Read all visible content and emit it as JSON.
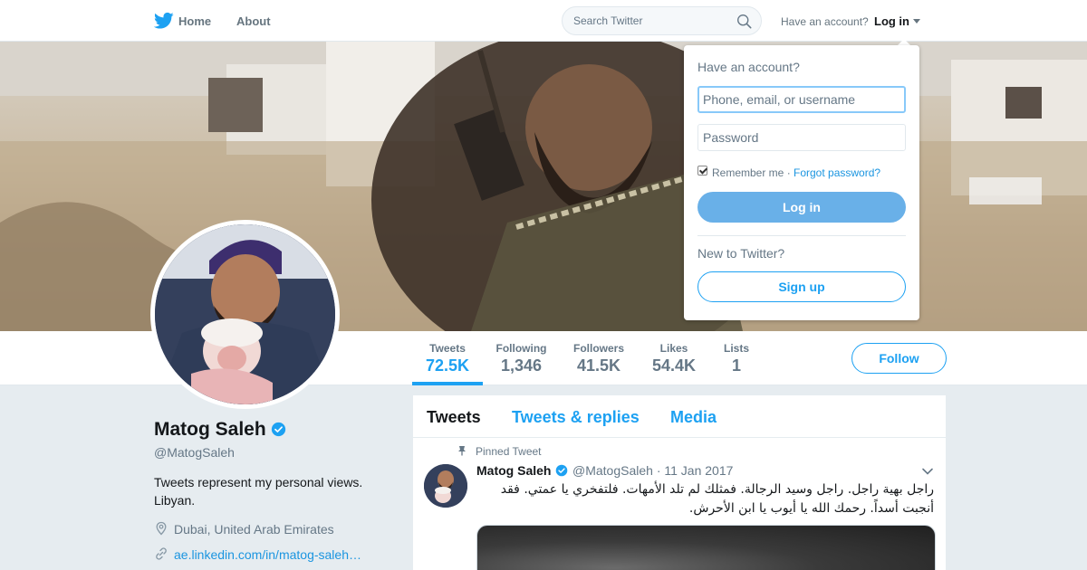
{
  "nav": {
    "home_label": "Home",
    "about_label": "About",
    "search_placeholder": "Search Twitter",
    "have_account": "Have an account?",
    "login_label": "Log in"
  },
  "profile": {
    "name": "Matog Saleh",
    "handle": "@MatogSaleh",
    "bio": "Tweets represent my personal views. Libyan.",
    "location": "Dubai, United Arab Emirates",
    "link": "ae.linkedin.com/in/matog-saleh…",
    "follow_label": "Follow"
  },
  "stats": [
    {
      "label": "Tweets",
      "value": "72.5K"
    },
    {
      "label": "Following",
      "value": "1,346"
    },
    {
      "label": "Followers",
      "value": "41.5K"
    },
    {
      "label": "Likes",
      "value": "54.4K"
    },
    {
      "label": "Lists",
      "value": "1"
    }
  ],
  "timeline": {
    "tabs": [
      "Tweets",
      "Tweets & replies",
      "Media"
    ],
    "pinned_label": "Pinned Tweet",
    "tweet": {
      "author": "Matog Saleh",
      "meta": "@MatogSaleh · 11 Jan 2017",
      "text": "راجل بهية راجل. راجل وسيد الرجالة. فمثلك لم تلد الأمهات. فلتفخري يا عمتي. فقد أنجبت أسداً. رحمك الله يا أيوب يا ابن الأحرش."
    }
  },
  "login_dropdown": {
    "title": "Have an account?",
    "username_placeholder": "Phone, email, or username",
    "password_placeholder": "Password",
    "remember_me": "Remember me",
    "separator": "·",
    "forgot": "Forgot password?",
    "login_button": "Log in",
    "new_to": "New to Twitter?",
    "signup_button": "Sign up",
    "remember_checked": true
  },
  "colors": {
    "accent": "#1da1f2",
    "link": "#1b95e0",
    "muted": "#657786",
    "page_bg": "#e6ecf0",
    "login_button_bg": "#69b0e8"
  },
  "icons": [
    "twitter-bird-icon",
    "home-icon",
    "search-icon",
    "chevron-down-icon",
    "verified-icon",
    "pin-icon",
    "location-icon",
    "link-icon"
  ]
}
